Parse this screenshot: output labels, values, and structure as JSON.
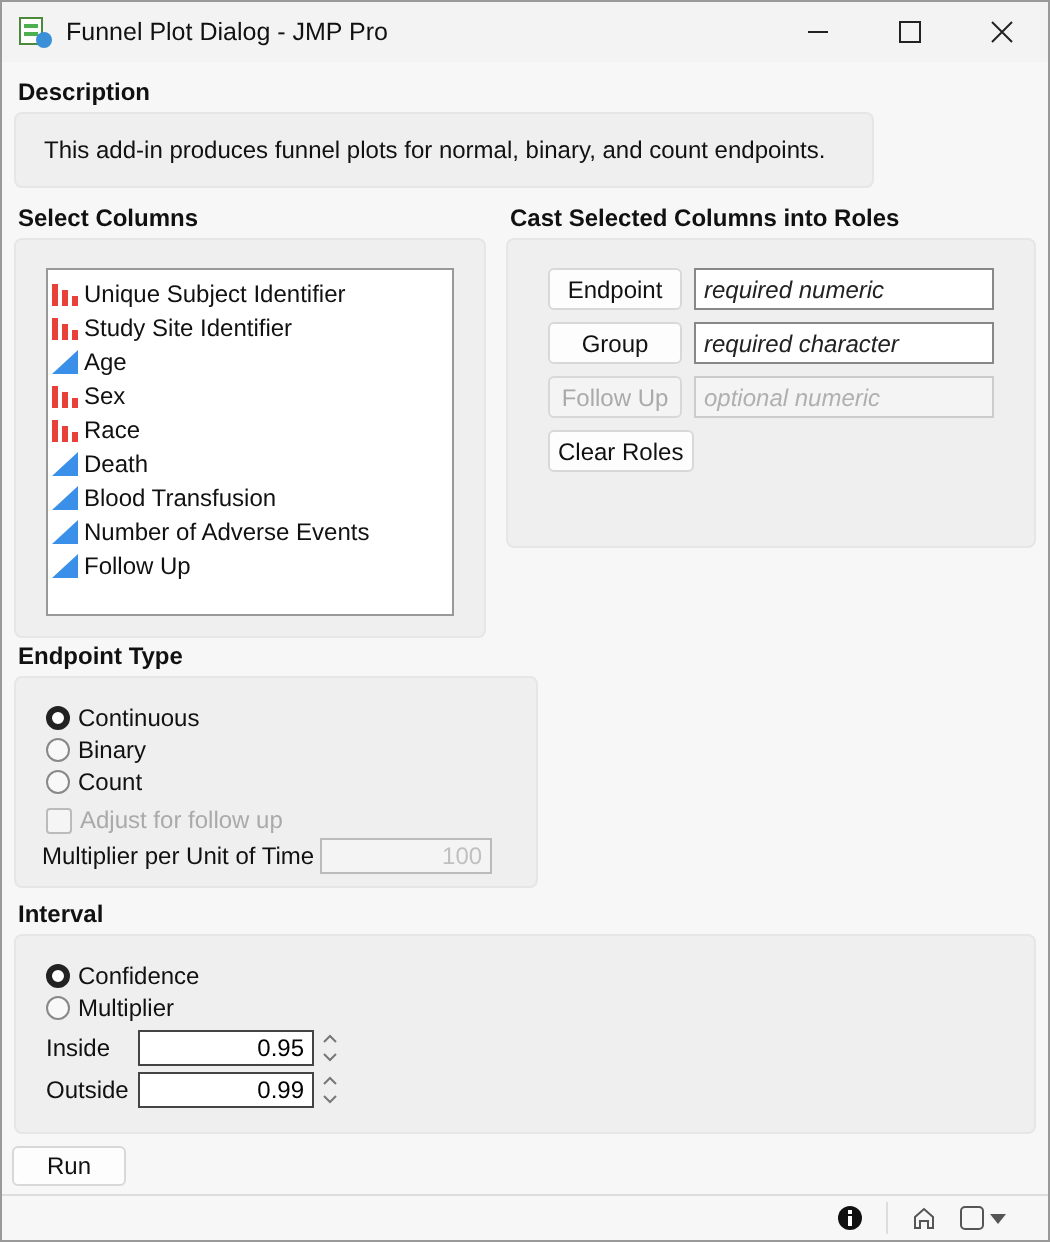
{
  "window": {
    "title": "Funnel Plot Dialog - JMP Pro"
  },
  "description": {
    "heading": "Description",
    "text": "This add-in produces funnel plots for normal, binary, and count endpoints."
  },
  "select_columns": {
    "heading": "Select Columns",
    "columns": [
      {
        "name": "Unique Subject Identifier",
        "kind": "nominal"
      },
      {
        "name": "Study Site Identifier",
        "kind": "nominal"
      },
      {
        "name": "Age",
        "kind": "continuous"
      },
      {
        "name": "Sex",
        "kind": "nominal"
      },
      {
        "name": "Race",
        "kind": "nominal"
      },
      {
        "name": "Death",
        "kind": "continuous"
      },
      {
        "name": "Blood Transfusion",
        "kind": "continuous"
      },
      {
        "name": "Number of Adverse Events",
        "kind": "continuous"
      },
      {
        "name": "Follow Up",
        "kind": "continuous"
      }
    ]
  },
  "roles": {
    "heading": "Cast Selected Columns into Roles",
    "items": [
      {
        "button": "Endpoint",
        "placeholder": "required numeric",
        "disabled": false
      },
      {
        "button": "Group",
        "placeholder": "required character",
        "disabled": false
      },
      {
        "button": "Follow Up",
        "placeholder": "optional numeric",
        "disabled": true
      }
    ],
    "clear_button": "Clear Roles"
  },
  "endpoint_type": {
    "heading": "Endpoint Type",
    "options": [
      {
        "label": "Continuous",
        "selected": true
      },
      {
        "label": "Binary",
        "selected": false
      },
      {
        "label": "Count",
        "selected": false
      }
    ],
    "adjust": {
      "label": "Adjust for follow up",
      "checked": false,
      "disabled": true
    },
    "multiplier": {
      "label": "Multiplier per Unit of Time",
      "value": "100",
      "disabled": true
    }
  },
  "interval": {
    "heading": "Interval",
    "options": [
      {
        "label": "Confidence",
        "selected": true
      },
      {
        "label": "Multiplier",
        "selected": false
      }
    ],
    "fields": [
      {
        "label": "Inside",
        "value": "0.95"
      },
      {
        "label": "Outside",
        "value": "0.99"
      }
    ]
  },
  "run_button": "Run"
}
